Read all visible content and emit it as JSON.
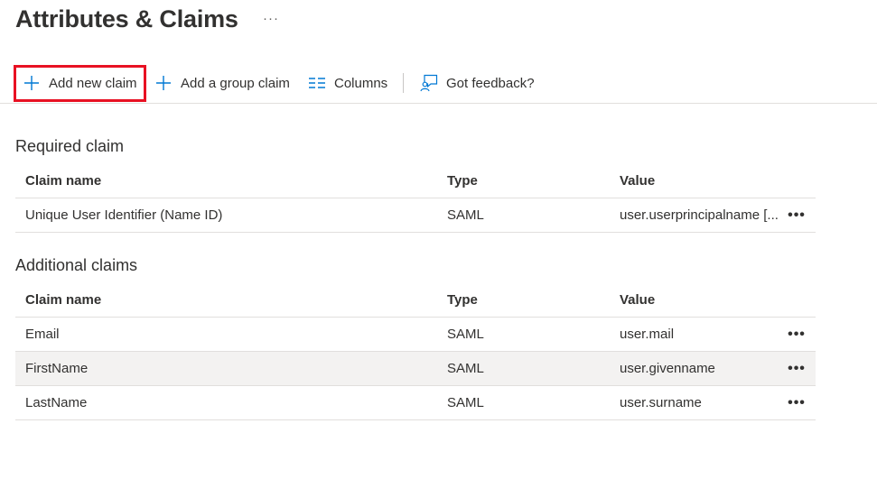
{
  "page": {
    "title": "Attributes & Claims",
    "title_more": "···"
  },
  "toolbar": {
    "add_new_claim": "Add new claim",
    "add_group_claim": "Add a group claim",
    "columns": "Columns",
    "feedback": "Got feedback?"
  },
  "required": {
    "title": "Required claim",
    "headers": {
      "name": "Claim name",
      "type": "Type",
      "value": "Value"
    },
    "rows": [
      {
        "name": "Unique User Identifier (Name ID)",
        "type": "SAML",
        "value": "user.userprincipalname [...",
        "more": "•••"
      }
    ]
  },
  "additional": {
    "title": "Additional claims",
    "headers": {
      "name": "Claim name",
      "type": "Type",
      "value": "Value"
    },
    "rows": [
      {
        "name": "Email",
        "type": "SAML",
        "value": "user.mail",
        "more": "•••"
      },
      {
        "name": "FirstName",
        "type": "SAML",
        "value": "user.givenname",
        "more": "•••"
      },
      {
        "name": "LastName",
        "type": "SAML",
        "value": "user.surname",
        "more": "•••"
      }
    ]
  },
  "colors": {
    "accent": "#0078d4",
    "highlight": "#e81123",
    "selected_row": "#f3f2f1"
  },
  "icons": {
    "add": "plus-icon",
    "columns": "columns-icon",
    "feedback": "feedback-icon"
  }
}
